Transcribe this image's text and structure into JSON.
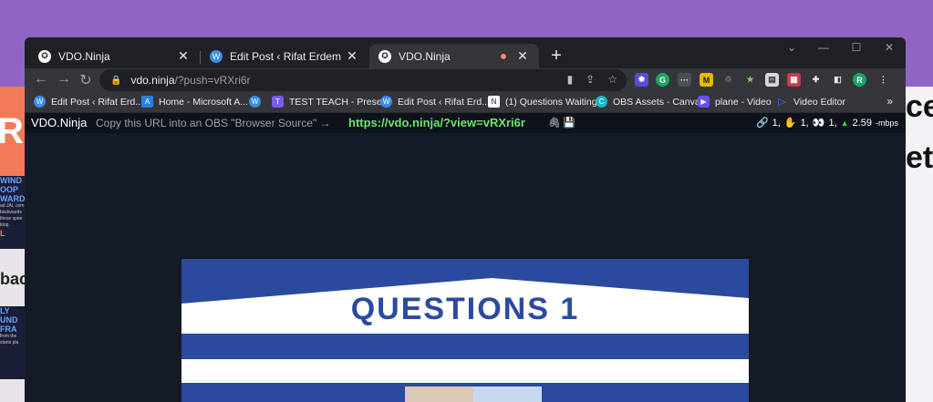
{
  "background": {
    "left_orange_text": "R",
    "left_card1_lines": [
      "WIND",
      "OOP",
      "WARD"
    ],
    "left_card1_small": [
      "ad JAI, com",
      "backwards",
      "these spee",
      "ktop."
    ],
    "left_card1_tail": "L",
    "left_text": "bac",
    "left_card2_lines": [
      "LY",
      "UND",
      "FRA"
    ],
    "left_card2_small": [
      "from the",
      "starts pla"
    ],
    "right_text1": "ce",
    "right_text2": "et"
  },
  "tabs": [
    {
      "title": "VDO.Ninja",
      "icon": "vdo-ninja-icon",
      "active": false
    },
    {
      "title": "Edit Post ‹ Rifat Erdem Sahin — V",
      "icon": "wordpress-icon",
      "active": false
    },
    {
      "title": "VDO.Ninja",
      "icon": "vdo-ninja-icon",
      "active": true,
      "recording": true
    }
  ],
  "newtab_label": "+",
  "address": {
    "host": "vdo.ninja",
    "path": "/?push=vRXri6r"
  },
  "profile_initial": "R",
  "bookmarks": [
    {
      "label": "Edit Post ‹ Rifat Erd...",
      "icon": "wordpress-icon",
      "color": "#3a8ee6"
    },
    {
      "label": "Home - Microsoft A...",
      "icon": "azure-icon",
      "color": "#2a7fe0"
    },
    {
      "label": "TEST TEACH - Prese...",
      "icon": "teach-icon",
      "color": "#7b5cf0"
    },
    {
      "label": "Edit Post ‹ Rifat Erd...",
      "icon": "wordpress-icon",
      "color": "#3a8ee6"
    },
    {
      "label": "(1) Questions Waiting",
      "icon": "notion-icon",
      "color": "#ffffff"
    },
    {
      "label": "OBS Assets - Canva",
      "icon": "canva-icon",
      "color": "#1eb6c8"
    },
    {
      "label": "plane - Video",
      "icon": "video-icon",
      "color": "#6c4ef5"
    },
    {
      "label": "Video Editor",
      "icon": "play-icon",
      "color": "#4a7df5"
    }
  ],
  "bookmarks_more": "»",
  "vdo": {
    "brand": "VDO.Ninja",
    "hint": "Copy this URL into an OBS \"Browser Source\" →",
    "link": "https://vdo.ninja/?view=vRXri6r",
    "stats": {
      "links": "1,",
      "hands": "1,",
      "viewers": "1,",
      "bitrate": "2.59",
      "unit": "-mbps"
    }
  },
  "video_frame": {
    "title": "QUESTIONS 1",
    "brand_color": "#2a4a9e"
  }
}
